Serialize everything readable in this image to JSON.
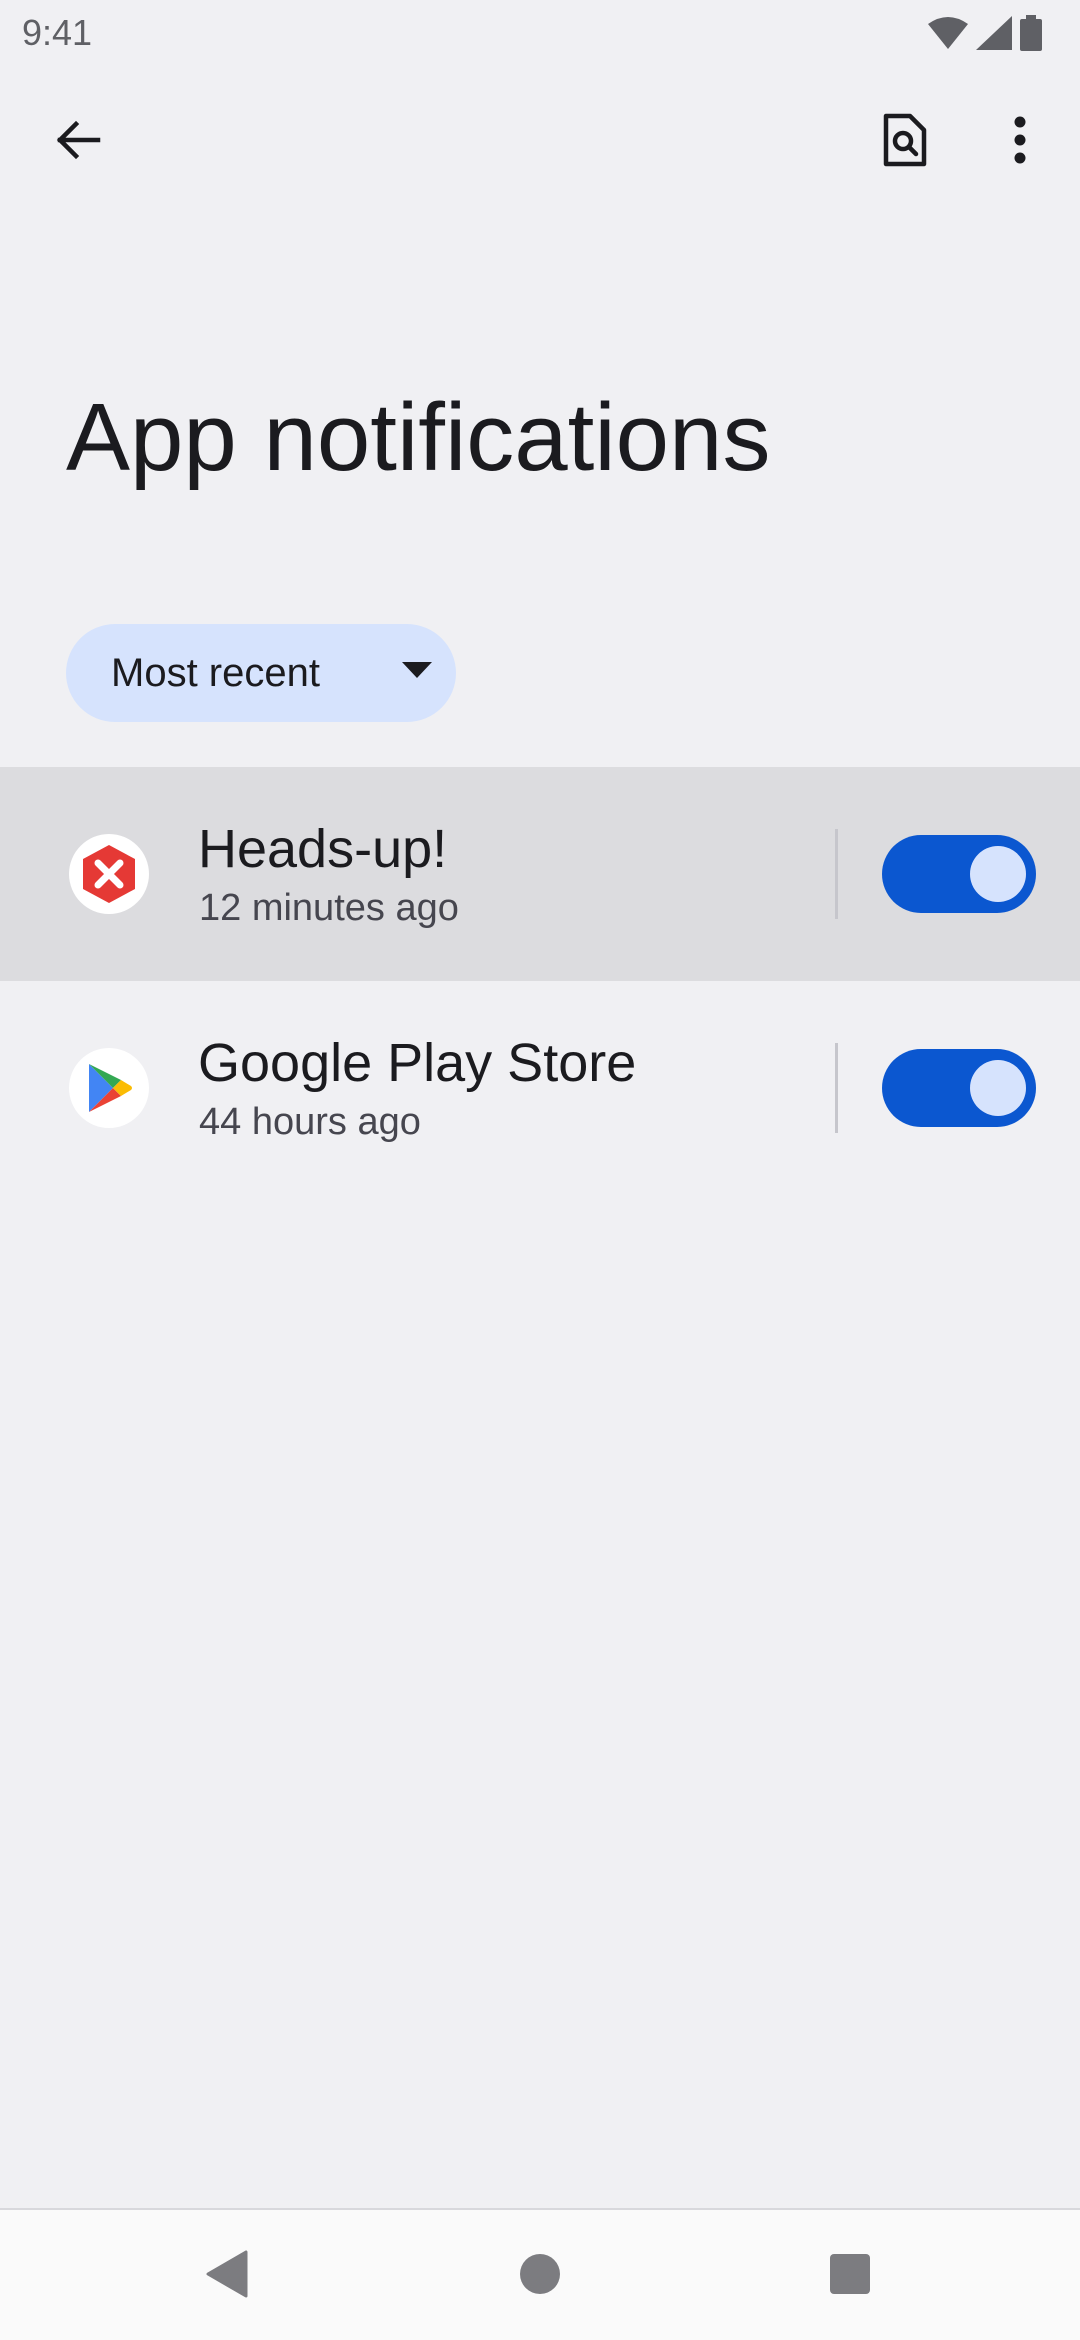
{
  "status_bar": {
    "time": "9:41",
    "icons": [
      "wifi-icon",
      "signal-icon",
      "battery-icon"
    ]
  },
  "toolbar": {
    "back_icon": "arrow-back-icon",
    "search_icon": "search-document-icon",
    "more_icon": "more-vertical-icon"
  },
  "page": {
    "title": "App notifications"
  },
  "sort": {
    "selected": "Most recent",
    "icon": "dropdown-arrow-icon"
  },
  "apps": [
    {
      "name": "Heads-up!",
      "time": "12 minutes ago",
      "icon": "heads-up-app-icon",
      "enabled": true,
      "highlighted": true
    },
    {
      "name": "Google Play Store",
      "time": "44 hours ago",
      "icon": "google-play-icon",
      "enabled": true,
      "highlighted": false
    }
  ],
  "navigation": {
    "back_icon": "nav-back-icon",
    "home_icon": "nav-home-icon",
    "recents_icon": "nav-recents-icon"
  },
  "colors": {
    "background": "#f0f0f3",
    "accent": "#0b57d0",
    "chip_background": "#d6e3fd",
    "highlight_row": "#dcdcdf",
    "heads_up_red": "#e53935"
  }
}
